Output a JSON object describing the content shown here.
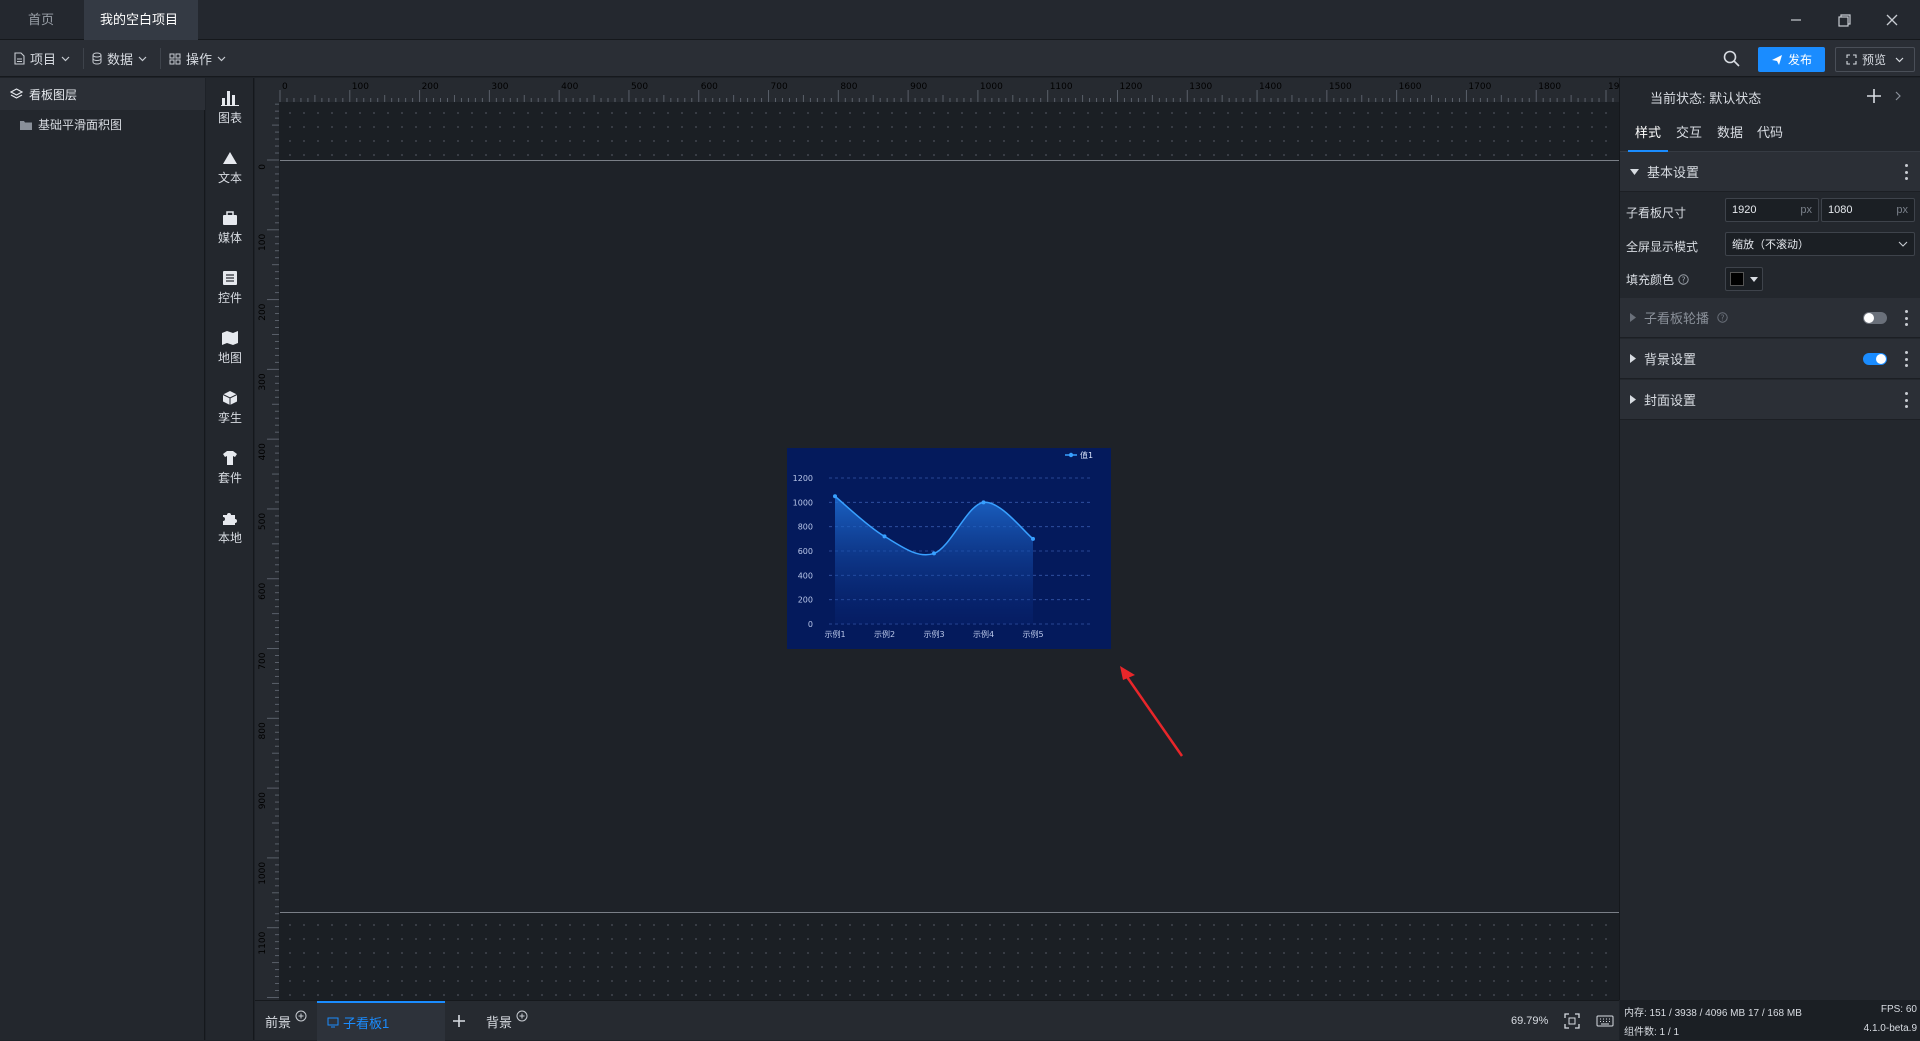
{
  "titlebar": {
    "tabs": [
      {
        "label": "首页"
      },
      {
        "label": "我的空白项目",
        "unsaved": true
      }
    ],
    "window_buttons": [
      "minimize-icon",
      "restore-icon",
      "close-icon"
    ]
  },
  "toolbar": {
    "menus": [
      {
        "label": "项目",
        "icon": "file-icon"
      },
      {
        "label": "数据",
        "icon": "database-icon"
      },
      {
        "label": "操作",
        "icon": "grid-icon"
      }
    ],
    "publish_label": "发布",
    "preview_label": "预览",
    "accent": "#1a8cff"
  },
  "layers": {
    "title": "看板图层",
    "items": [
      {
        "label": "基础平滑面积图",
        "icon": "folder-icon"
      }
    ]
  },
  "widgets": [
    {
      "label": "图表",
      "icon": "bar-chart-icon"
    },
    {
      "label": "文本",
      "icon": "text-icon"
    },
    {
      "label": "媒体",
      "icon": "media-icon"
    },
    {
      "label": "控件",
      "icon": "control-icon"
    },
    {
      "label": "地图",
      "icon": "map-icon"
    },
    {
      "label": "孪生",
      "icon": "cube-icon"
    },
    {
      "label": "套件",
      "icon": "suite-icon"
    },
    {
      "label": "本地",
      "icon": "puzzle-icon"
    }
  ],
  "rulers": {
    "h_ticks": [
      "0",
      "100",
      "200",
      "300",
      "400",
      "500",
      "600",
      "700",
      "800",
      "900",
      "1000",
      "1100",
      "1200",
      "1300",
      "1400",
      "1500",
      "1600",
      "1700",
      "1800",
      "1900"
    ],
    "v_ticks": [
      "0",
      "100",
      "200",
      "300",
      "400",
      "500",
      "600",
      "700",
      "800",
      "900",
      "1000",
      "1100"
    ]
  },
  "chart_data": {
    "type": "area",
    "smooth": true,
    "categories": [
      "示例1",
      "示例2",
      "示例3",
      "示例4",
      "示例5"
    ],
    "series": [
      {
        "name": "值1",
        "values": [
          1050,
          720,
          580,
          1000,
          700
        ]
      }
    ],
    "ylim": [
      0,
      1200
    ],
    "yticks": [
      "0",
      "200",
      "400",
      "600",
      "800",
      "1000",
      "1200"
    ],
    "grid": true,
    "legend": "top-right",
    "colors": {
      "background": "#041a5c",
      "line": "#38a0ff"
    }
  },
  "bottombar": {
    "foreground": "前景",
    "subboard": "子看板1",
    "background": "背景",
    "zoom": "69.79%"
  },
  "rpanel": {
    "status_label": "当前状态:",
    "status_value": "默认状态",
    "tabs": [
      "样式",
      "交互",
      "数据",
      "代码"
    ],
    "basic_title": "基本设置",
    "size_label": "子看板尺寸",
    "width": "1920",
    "height": "1080",
    "unit": "px",
    "fullscreen_label": "全屏显示模式",
    "fullscreen_value": "缩放（不滚动）",
    "fill_label": "填充颜色",
    "fill_color": "#000000",
    "sections": [
      {
        "title": "子看板轮播",
        "toggle": false,
        "help": true
      },
      {
        "title": "背景设置",
        "toggle": true
      },
      {
        "title": "封面设置"
      }
    ]
  },
  "statusbar": {
    "memory": "内存: 151 / 3938 / 4096 MB 17 / 168 MB",
    "components": "组件数: 1 / 1",
    "fps": "FPS: 60",
    "version": "4.1.0-beta.9"
  }
}
